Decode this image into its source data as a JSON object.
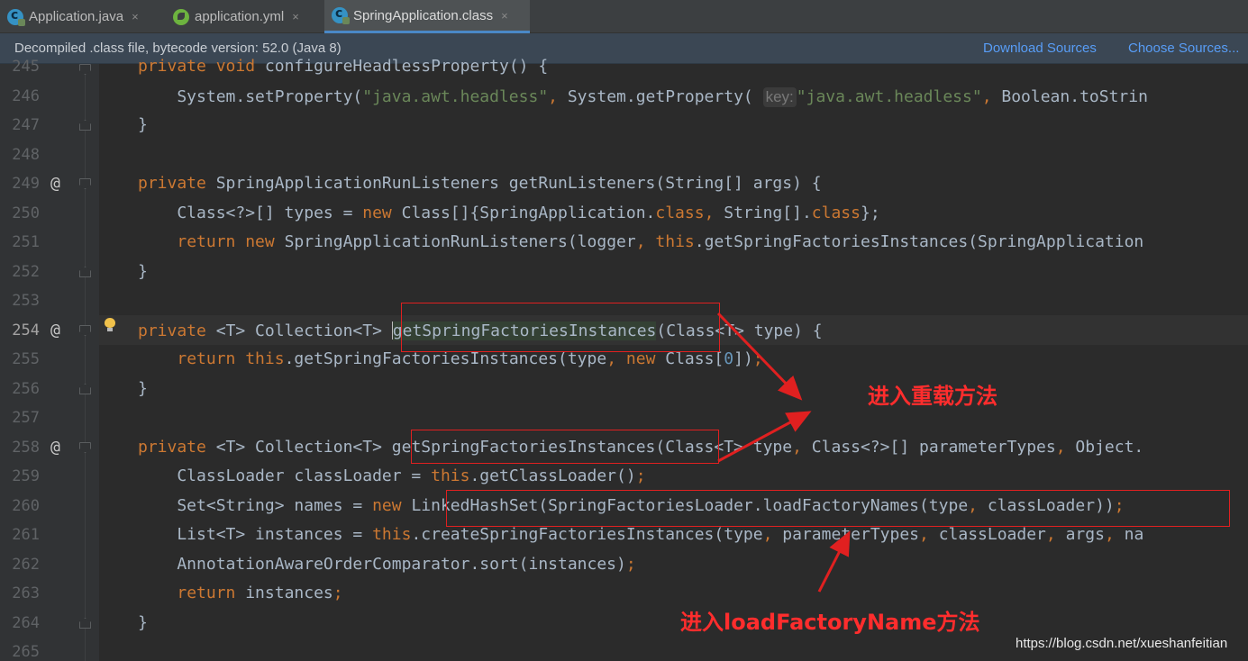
{
  "tabs": [
    {
      "label": "Application.java",
      "icon": "java-class-icon",
      "active": false
    },
    {
      "label": "application.yml",
      "icon": "spring-config-icon",
      "active": false
    },
    {
      "label": "SpringApplication.class",
      "icon": "java-class-icon",
      "active": true
    }
  ],
  "tab_close_glyph": "×",
  "infobar": {
    "message": "Decompiled .class file, bytecode version: 52.0 (Java 8)",
    "download_sources": "Download Sources",
    "choose_sources": "Choose Sources..."
  },
  "gutter": {
    "line_numbers": [
      "245",
      "246",
      "247",
      "248",
      "249",
      "250",
      "251",
      "252",
      "253",
      "254",
      "255",
      "256",
      "257",
      "258",
      "259",
      "260",
      "261",
      "262",
      "263",
      "264",
      "265"
    ],
    "override_marker": "@"
  },
  "code": {
    "l245": {
      "a": "private ",
      "b": "void ",
      "c": "configureHeadlessProperty() {"
    },
    "l246": {
      "a": "    System.setProperty(",
      "b": "\"java.awt.headless\"",
      "c": ", ",
      "d": "System.getProperty(",
      "hint": "key:",
      "e": "\"java.awt.headless\"",
      "f": ", ",
      "g": "Boolean.toStrin"
    },
    "brace_close": "}",
    "l249": {
      "a": "private ",
      "b": "SpringApplicationRunListeners getRunListeners(String[] args) {"
    },
    "l250": {
      "a": "    Class<?>[] types = ",
      "b": "new ",
      "c": "Class[]{SpringApplication.",
      "d": "class",
      "e": ", ",
      "f": "String[].",
      "g": "class",
      "h": "};"
    },
    "l251": {
      "a": "    ",
      "b": "return new ",
      "c": "SpringApplicationRunListeners(logger",
      "d": ", ",
      "e": "this",
      "f": ".getSpringFactoriesInstances(SpringApplication"
    },
    "l254": {
      "a": "private ",
      "b": "<T> Collection<T> ",
      "c": "getSpringFactoriesInstances",
      "d": "(Class<T> type) {"
    },
    "l255": {
      "a": "    ",
      "b": "return this",
      "c": ".getSpringFactoriesInstances(type",
      "d": ", ",
      "e": "new ",
      "f": "Class[",
      "g": "0",
      "h": "])",
      "i": ";"
    },
    "l258": {
      "a": "private ",
      "b": "<T> Collection<T> getSpringFactoriesInstances(Class<T> type",
      "c": ", ",
      "d": "Class<?>[] parameterTypes",
      "e": ", ",
      "f": "Object."
    },
    "l259": {
      "a": "    ClassLoader classLoader = ",
      "b": "this",
      "c": ".getClassLoader()",
      "d": ";"
    },
    "l260": {
      "a": "    Set<String> names = ",
      "b": "new ",
      "c": "LinkedHashSet(SpringFactoriesLoader.loadFactoryNames(type",
      "d": ", ",
      "e": "classLoader))",
      "f": ";"
    },
    "l261": {
      "a": "    List<T> instances = ",
      "b": "this",
      "c": ".createSpringFactoriesInstances(type",
      "d": ", ",
      "e": "parameterTypes",
      "f": ", ",
      "g": "classLoader",
      "h": ", ",
      "i": "args",
      "j": ", ",
      "k": "na"
    },
    "l262": {
      "a": "    AnnotationAwareOrderComparator.sort(instances)",
      "b": ";"
    },
    "l263": {
      "a": "    ",
      "b": "return ",
      "c": "instances",
      "d": ";"
    }
  },
  "annotations": {
    "overload": "进入重载方法",
    "load_factory": "进入loadFactoryName方法"
  },
  "watermark": "https://blog.csdn.net/xueshanfeitian",
  "colors": {
    "annotation": "#ff2d2d",
    "keyword": "#cc7832",
    "string": "#6a8759",
    "number": "#6897bb",
    "link": "#589df6"
  }
}
